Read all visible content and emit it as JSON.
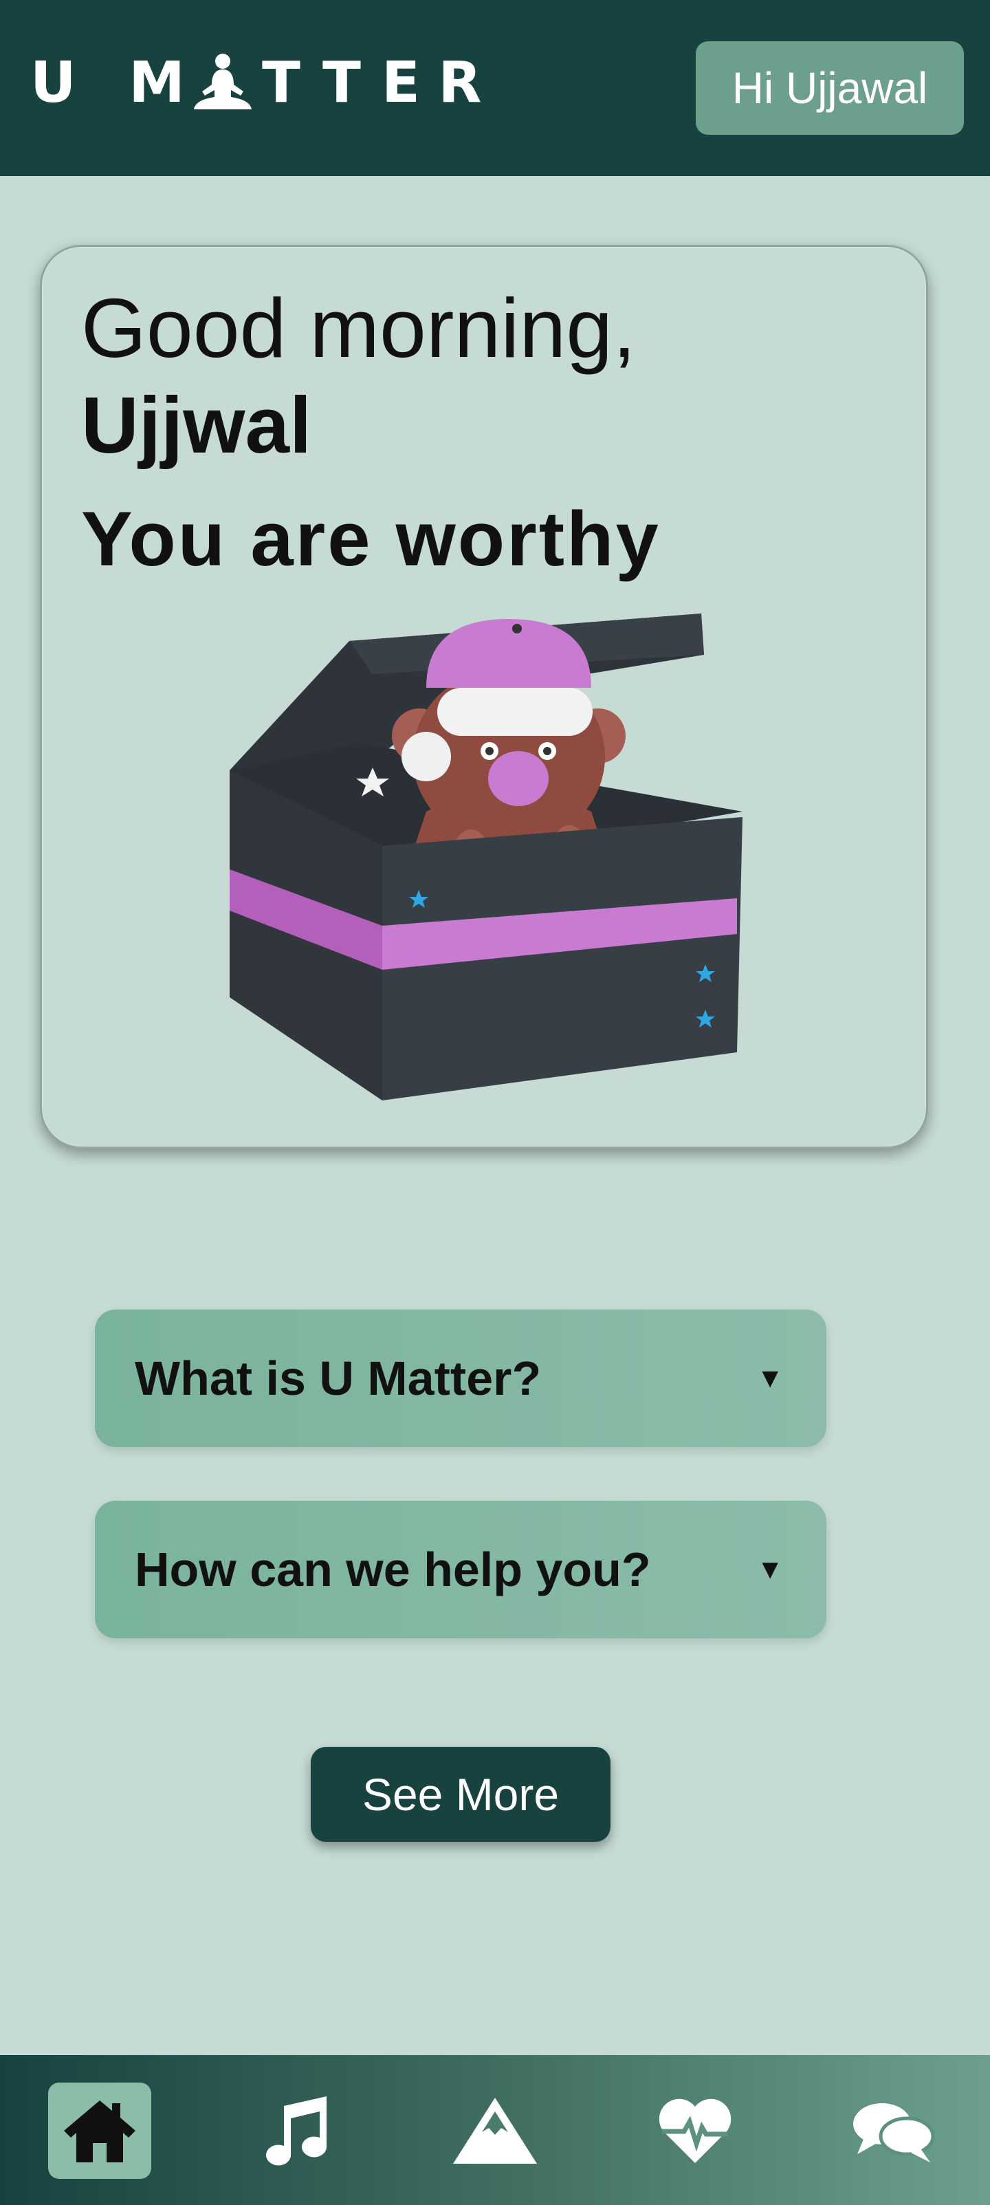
{
  "header": {
    "logo_letters": [
      "U",
      "M",
      "T",
      "T",
      "E",
      "R"
    ],
    "logo_icon": "meditation-icon",
    "greeting_button": "Hi Ujjawal"
  },
  "hero": {
    "greeting": "Good morning,",
    "name": "Ujjwal",
    "affirmation": "You are worthy"
  },
  "faq": [
    {
      "question": "What is U Matter?",
      "icon": "triangle-down-icon"
    },
    {
      "question": "How can we help you?",
      "icon": "triangle-down-icon"
    }
  ],
  "see_more_label": "See More",
  "nav": {
    "items": [
      {
        "icon": "home-icon",
        "active": true
      },
      {
        "icon": "music-icon",
        "active": false
      },
      {
        "icon": "mountain-icon",
        "active": false
      },
      {
        "icon": "heartbeat-icon",
        "active": false
      },
      {
        "icon": "chat-icon",
        "active": false
      }
    ]
  },
  "colors": {
    "header_bg": "#174240",
    "page_bg": "#c5dbd3",
    "accent": "#6da08c",
    "faq_bg": "#7ab39c",
    "mascot_hat": "#c87bd0",
    "box": "#363b42"
  }
}
